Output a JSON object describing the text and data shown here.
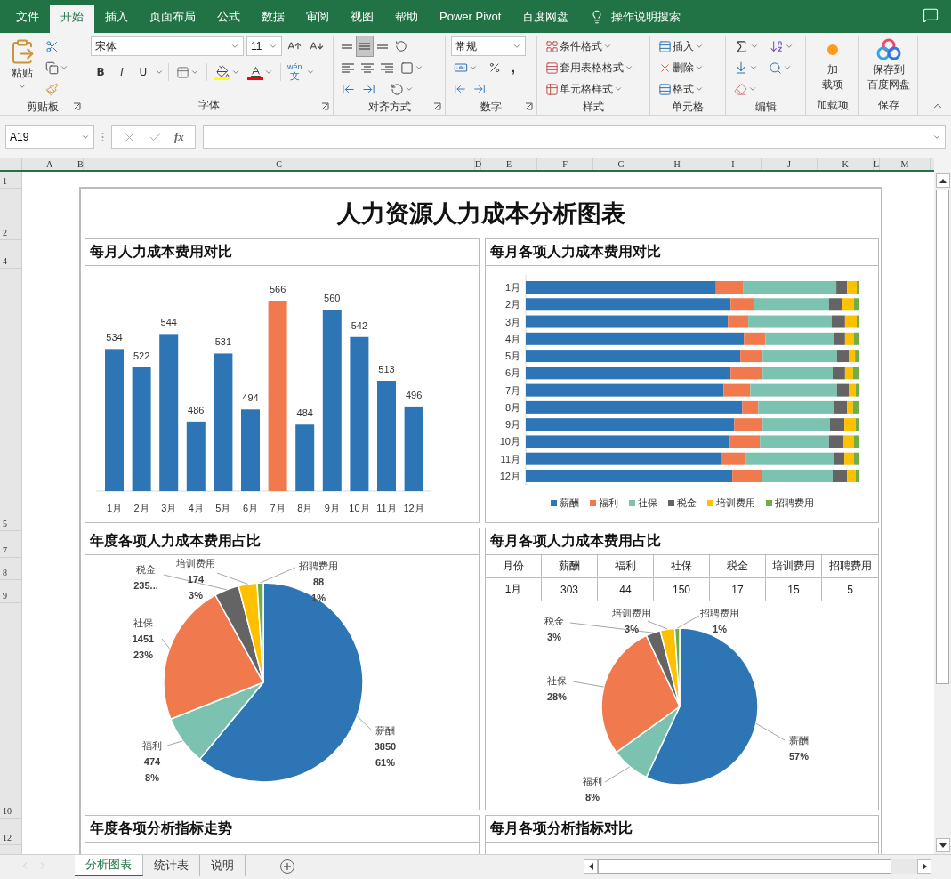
{
  "title_bar": {
    "tabs": [
      {
        "label": "文件",
        "selected": false
      },
      {
        "label": "开始",
        "selected": true
      },
      {
        "label": "插入",
        "selected": false
      },
      {
        "label": "页面布局",
        "selected": false
      },
      {
        "label": "公式",
        "selected": false
      },
      {
        "label": "数据",
        "selected": false
      },
      {
        "label": "审阅",
        "selected": false
      },
      {
        "label": "视图",
        "selected": false
      },
      {
        "label": "帮助",
        "selected": false
      },
      {
        "label": "Power Pivot",
        "selected": false
      },
      {
        "label": "百度网盘",
        "selected": false
      }
    ],
    "search": "操作说明搜索"
  },
  "ribbon": {
    "groups": [
      {
        "kind": "clipboard",
        "label": "剪贴板",
        "launcher": true,
        "paste": "粘贴"
      },
      {
        "kind": "font",
        "label": "字体",
        "launcher": true,
        "font": "宋体",
        "size": "11",
        "bold": "B",
        "italic": "I",
        "underline": "U",
        "phonetic_top": "wén",
        "phonetic_bottom": "文"
      },
      {
        "kind": "align",
        "label": "对齐方式",
        "launcher": true
      },
      {
        "kind": "number",
        "label": "数字",
        "launcher": true,
        "format": "常规",
        "comma": ","
      },
      {
        "kind": "styles",
        "label": "样式",
        "launcher": false,
        "items": [
          "条件格式",
          "套用表格格式",
          "单元格样式"
        ]
      },
      {
        "kind": "cells",
        "label": "单元格",
        "launcher": false,
        "items": [
          "插入",
          "删除",
          "格式"
        ]
      },
      {
        "kind": "editing",
        "label": "编辑",
        "launcher": false
      },
      {
        "kind": "addins",
        "label": "加载项",
        "launcher": false,
        "button": [
          "加",
          "载项"
        ]
      },
      {
        "kind": "save",
        "label": "保存",
        "launcher": false,
        "button": [
          "保存到",
          "百度网盘"
        ]
      }
    ]
  },
  "formula_bar": {
    "name_box": "A19",
    "fx": "fx"
  },
  "sheet": {
    "columns": [
      "A",
      "B",
      "C",
      "D",
      "E",
      "F",
      "G",
      "H",
      "I",
      "J",
      "K",
      "L",
      "M"
    ],
    "rows": [
      "1",
      "2",
      "4",
      "5",
      "7",
      "8",
      "9",
      "10",
      "12"
    ]
  },
  "dashboard": {
    "title": "人力资源人力成本分析图表",
    "panels": [
      {
        "kind": "column_chart",
        "title": "每月人力成本费用对比",
        "chart_data": {
          "type": "bar",
          "categories": [
            "1月",
            "2月",
            "3月",
            "4月",
            "5月",
            "6月",
            "7月",
            "8月",
            "9月",
            "10月",
            "11月",
            "12月"
          ],
          "values": [
            534,
            522,
            544,
            486,
            531,
            494,
            566,
            484,
            560,
            542,
            513,
            496
          ],
          "colors": [
            "#2e75b6",
            "#2e75b6",
            "#2e75b6",
            "#2e75b6",
            "#2e75b6",
            "#2e75b6",
            "#f07a4d",
            "#2e75b6",
            "#2e75b6",
            "#2e75b6",
            "#2e75b6",
            "#2e75b6"
          ],
          "ylim": [
            440,
            566
          ],
          "data_labels": true
        }
      },
      {
        "kind": "stacked_bars",
        "title": "每月各项人力成本费用对比",
        "categories": [
          "1月",
          "2月",
          "3月",
          "4月",
          "5月",
          "6月",
          "7月",
          "8月",
          "9月",
          "10月",
          "11月",
          "12月"
        ],
        "legend": [
          {
            "label": "薪酬",
            "color": "#2e75b6"
          },
          {
            "label": "福利",
            "color": "#f07a4d"
          },
          {
            "label": "社保",
            "color": "#7cc2b0"
          },
          {
            "label": "税金",
            "color": "#646464"
          },
          {
            "label": "培训费用",
            "color": "#ffc000"
          },
          {
            "label": "招聘费用",
            "color": "#70ad47"
          }
        ]
      },
      {
        "kind": "pie",
        "title": "年度各项人力成本费用占比",
        "chart_data": {
          "type": "pie",
          "categories": [
            "薪酬",
            "福利",
            "社保",
            "税金",
            "培训费用",
            "招聘费用"
          ],
          "values": [
            61,
            8,
            23,
            4,
            3,
            1
          ],
          "colors": [
            "#2e75b6",
            "#7cc2b0",
            "#f07a4d",
            "#646464",
            "#ffc000",
            "#70ad47"
          ],
          "value_labels": [
            [
              "3850",
              "61%"
            ],
            [
              "474",
              "8%"
            ],
            [
              "1451",
              "23%"
            ],
            [
              "235..."
            ],
            [
              "174",
              "3%"
            ],
            [
              "88",
              "1%"
            ]
          ]
        }
      },
      {
        "kind": "table_pie",
        "title": "每月各项人力成本费用占比",
        "table": {
          "columns": [
            "月份",
            "薪酬",
            "福利",
            "社保",
            "税金",
            "培训费用",
            "招聘费用"
          ],
          "rows": [
            [
              "1月",
              "303",
              "44",
              "150",
              "17",
              "15",
              "5"
            ]
          ]
        },
        "chart_data": {
          "type": "pie",
          "categories": [
            "薪酬",
            "福利",
            "社保",
            "税金",
            "培训费用",
            "招聘费用"
          ],
          "values": [
            57,
            8,
            28,
            3,
            3,
            1
          ],
          "colors": [
            "#2e75b6",
            "#7cc2b0",
            "#f07a4d",
            "#646464",
            "#ffc000",
            "#70ad47"
          ],
          "value_labels": [
            [
              "57%"
            ],
            [
              "8%"
            ],
            [
              "28%"
            ],
            [
              "3%"
            ],
            [
              "3%"
            ],
            [
              "1%"
            ]
          ]
        }
      },
      {
        "kind": "empty",
        "title": "年度各项分析指标走势"
      },
      {
        "kind": "empty",
        "title": "每月各项分析指标对比"
      }
    ]
  },
  "sheet_tabs": [
    {
      "label": "分析图表",
      "selected": true
    },
    {
      "label": "统计表",
      "selected": false
    },
    {
      "label": "说明",
      "selected": false
    }
  ]
}
